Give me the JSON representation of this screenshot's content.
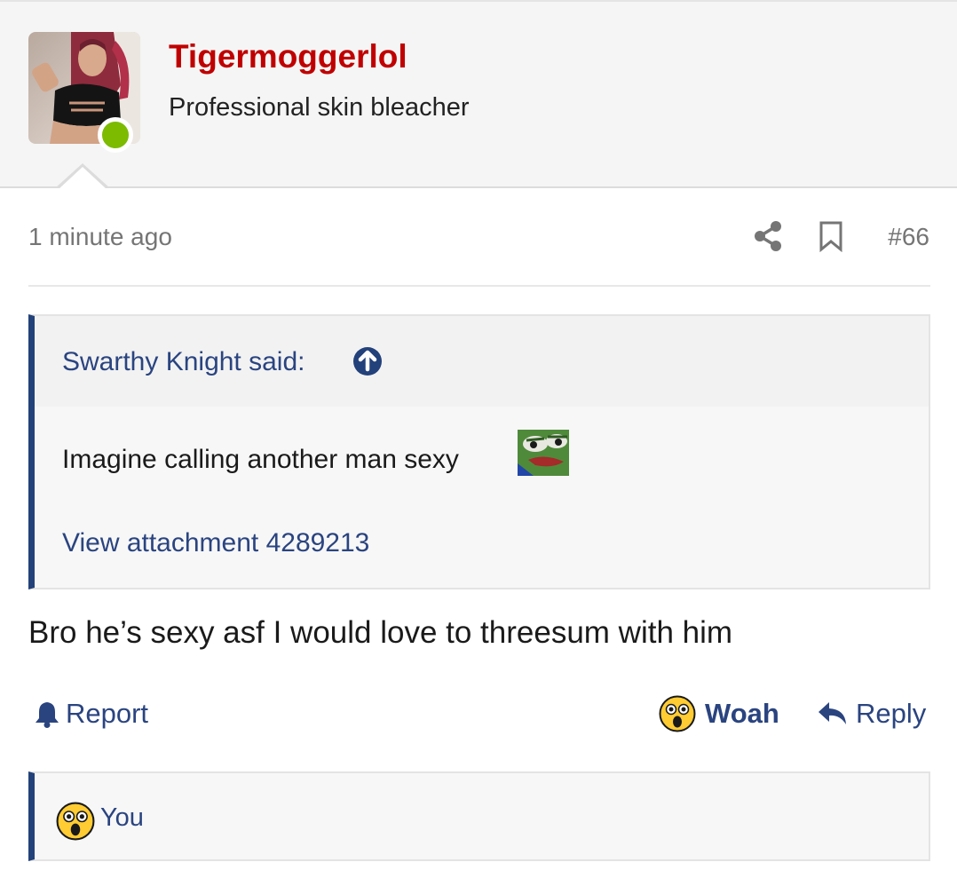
{
  "user": {
    "username": "Tigermoggerlol",
    "title": "Professional skin bleacher",
    "online": true
  },
  "post": {
    "time": "1 minute ago",
    "number": "#66",
    "body": "Bro he’s sexy asf I would love to threesum with him"
  },
  "quote": {
    "author_said": "Swarthy Knight said:",
    "text": "Imagine calling another man sexy",
    "attachment": "View attachment 4289213"
  },
  "actions": {
    "report": "Report",
    "reaction": "Woah",
    "reply": "Reply"
  },
  "reactions": {
    "users": "You"
  },
  "icons": {
    "share": "share-icon",
    "bookmark": "bookmark-icon",
    "up": "arrow-up-circle-icon",
    "report": "bell-icon",
    "reaction": "astonished-face-icon",
    "reply": "reply-arrow-icon",
    "quote_emoji": "pepe-frog-emoji"
  },
  "colors": {
    "username": "#c00000",
    "link": "#2a4480",
    "accent_bar": "#23417a",
    "online": "#7cbb00",
    "muted": "#757575"
  }
}
